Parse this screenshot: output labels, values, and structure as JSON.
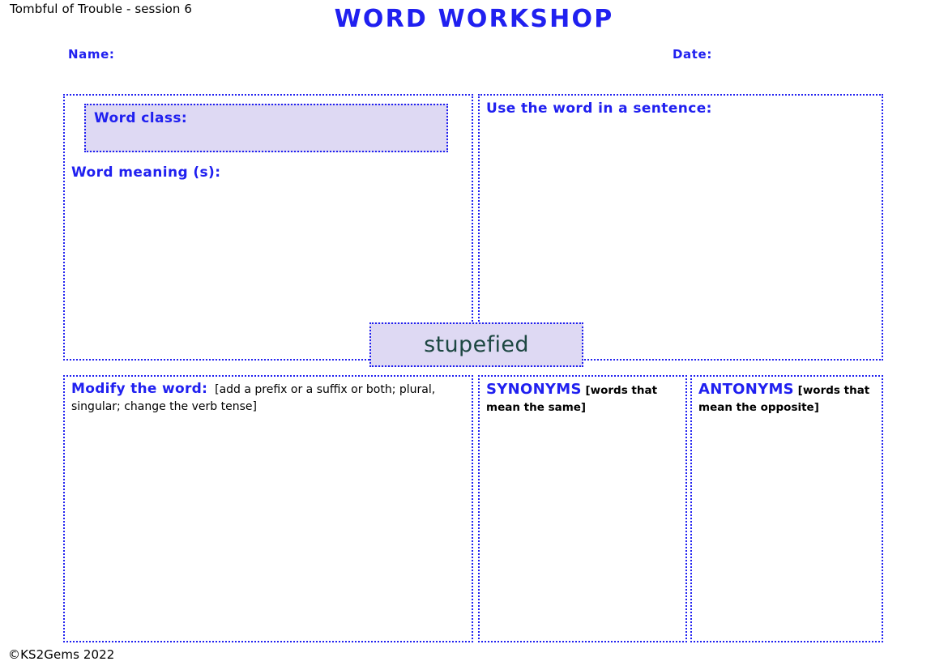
{
  "header": {
    "session_label": "Tombful of Trouble - session 6",
    "title": "WORD WORKSHOP",
    "name_label": "Name:",
    "date_label": "Date:"
  },
  "word": {
    "text": "stupefied"
  },
  "panels": {
    "word_class_label": "Word class:",
    "word_meaning_label": "Word meaning (s):",
    "sentence_label": "Use the word in a sentence:",
    "modify": {
      "title": "Modify the word:",
      "note": "[add a prefix or a suffix or both; plural, singular; change the verb tense]"
    },
    "synonyms": {
      "title": "SYNONYMS",
      "note": "[words that mean the same]"
    },
    "antonyms": {
      "title": "ANTONYMS",
      "note": "[words that mean the opposite]"
    }
  },
  "footer": {
    "copyright": "©KS2Gems 2022"
  },
  "colors": {
    "accent_blue": "#2020f0",
    "chip_fill": "#ded9f3",
    "word_text": "#1d4742",
    "body_text": "#000000",
    "page_background": "#ffffff"
  }
}
